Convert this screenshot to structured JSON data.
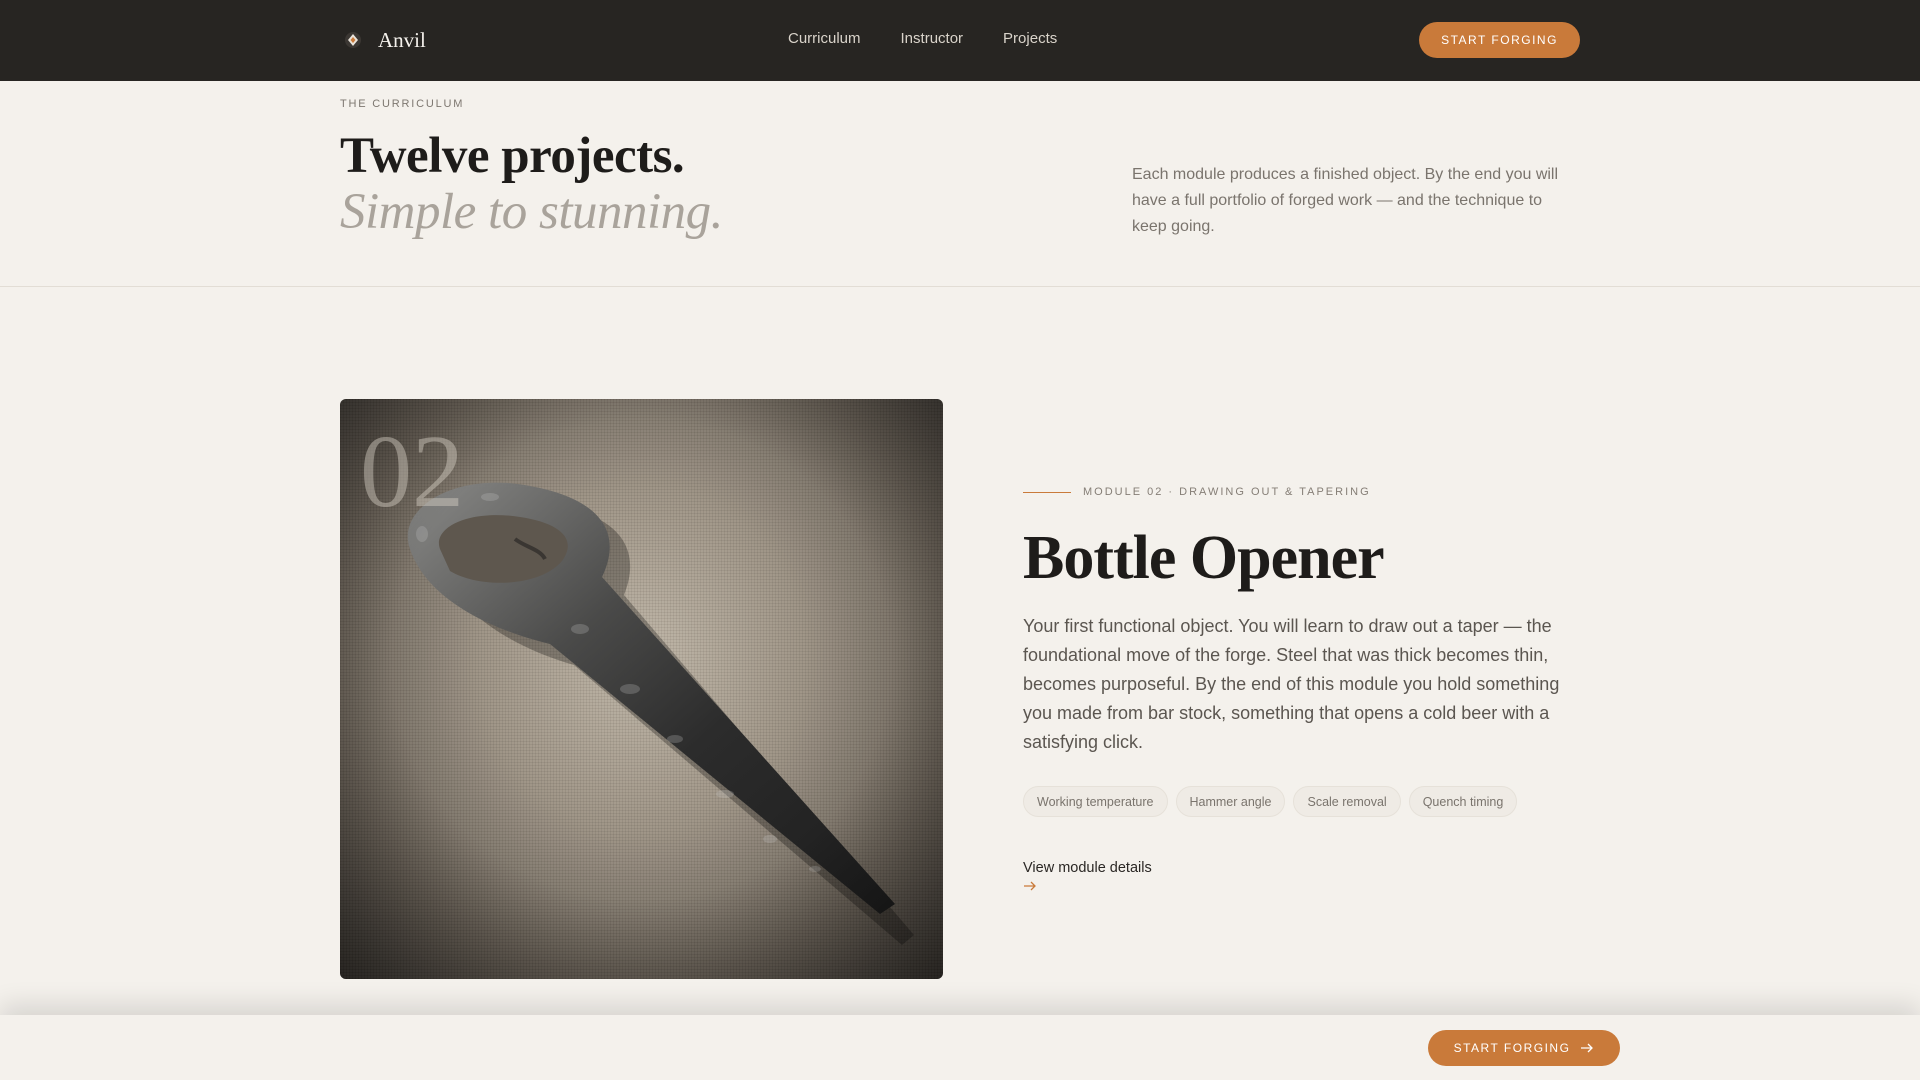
{
  "nav": {
    "brand": "Anvil",
    "links": [
      "Curriculum",
      "Instructor",
      "Projects"
    ],
    "cta": "START FORGING"
  },
  "hero": {
    "eyebrow": "THE CURRICULUM",
    "title": "Twelve projects.",
    "subtitle": "Simple to stunning.",
    "description": "Each module produces a finished object. By the end you will have a full portfolio of forged work — and the technique to keep going."
  },
  "module": {
    "number": "02",
    "label": "MODULE 02 · DRAWING OUT & TAPERING",
    "title": "Bottle Opener",
    "description": "Your first functional object. You will learn to draw out a taper — the foundational move of the forge. Steel that was thick becomes thin, becomes purposeful. By the end of this module you hold something you made from bar stock, something that opens a cold beer with a satisfying click.",
    "tags": [
      "Working temperature",
      "Hammer angle",
      "Scale removal",
      "Quench timing"
    ],
    "link": "View module details",
    "image": "forged-bottle-opener-photo"
  },
  "sticky": {
    "cta": "START FORGING"
  },
  "colors": {
    "accent": "#c97a3a",
    "nav_bg": "#272522",
    "page_bg": "#f4f1ec"
  },
  "icons": {
    "brand": "anvil-logo-icon",
    "link_arrow": "arrow-right-icon",
    "cta_arrow": "arrow-right-icon"
  }
}
